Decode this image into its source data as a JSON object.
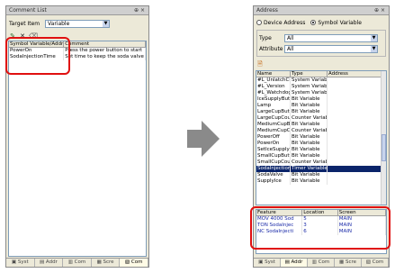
{
  "comment_list": {
    "title": "Comment List",
    "pin": "⊕",
    "close": "×",
    "target_item_label": "Target Item",
    "target_item_value": "Variable",
    "headers": [
      "Symbol Variable/Address",
      "Comment"
    ],
    "rows": [
      {
        "name": "PowerOn",
        "comment": "Press the power button to start"
      },
      {
        "name": "SodaInjectionTime",
        "comment": "Set time to keep the soda valve"
      }
    ],
    "tabs": [
      "Syst",
      "Addr",
      "Com",
      "Scre",
      "Com"
    ]
  },
  "address": {
    "title": "Address",
    "pin": "⊕",
    "close": "×",
    "radio_device": "Device Address",
    "radio_symbol": "Symbol Variable",
    "type_label": "Type",
    "type_value": "All",
    "attribute_label": "Attribute",
    "attribute_value": "All",
    "headers": [
      "Name",
      "Type",
      "Address"
    ],
    "rows": [
      {
        "name": "#L_UnlatchCle",
        "type": "System Variab"
      },
      {
        "name": "#L_Version",
        "type": "System Variab"
      },
      {
        "name": "#L_WatchdogTi",
        "type": "System Variab"
      },
      {
        "name": "IceSupplyButto",
        "type": "Bit Variable"
      },
      {
        "name": "Lamp",
        "type": "Bit Variable"
      },
      {
        "name": "LargeCupButto",
        "type": "Bit Variable"
      },
      {
        "name": "LargeCupCoun",
        "type": "Counter Variab"
      },
      {
        "name": "MediumCupBut",
        "type": "Bit Variable"
      },
      {
        "name": "MediumCupCou",
        "type": "Counter Variab"
      },
      {
        "name": "PowerOff",
        "type": "Bit Variable"
      },
      {
        "name": "PowerOn",
        "type": "Bit Variable"
      },
      {
        "name": "SetIceSupplyC",
        "type": "Bit Variable"
      },
      {
        "name": "SmallCupButto",
        "type": "Bit Variable"
      },
      {
        "name": "SmallCupCoun",
        "type": "Counter Variab"
      },
      {
        "name": "SodaInjectionT",
        "type": "Timer Variable"
      },
      {
        "name": "SodaValve",
        "type": "Bit Variable"
      },
      {
        "name": "SupplyIce",
        "type": "Bit Variable"
      }
    ],
    "feature_headers": [
      "Feature",
      "Location",
      "Screen"
    ],
    "feature_rows": [
      {
        "feature": "MOV 4000 Sod",
        "location": "5",
        "screen": "MAIN"
      },
      {
        "feature": "TON SodaInjec",
        "location": "3",
        "screen": "MAIN"
      },
      {
        "feature": "NC SodaInjecti",
        "location": "6",
        "screen": "MAIN"
      }
    ],
    "tabs": [
      "Syst",
      "Addr",
      "Com",
      "Scre",
      "Com"
    ]
  },
  "arrow_color": "#8a8a8a",
  "highlight_color": "#e01010"
}
